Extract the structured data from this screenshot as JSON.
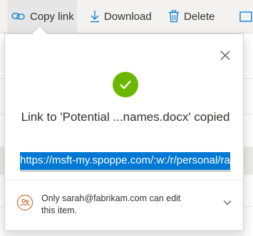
{
  "toolbar": {
    "copy_link_label": "Copy link",
    "download_label": "Download",
    "delete_label": "Delete"
  },
  "dialog": {
    "message": "Link to 'Potential ...names.docx' copied",
    "link_url": "https://msft-my.spoppe.com/:w:/r/personal/ra",
    "permission_text": "Only sarah@fabrikam.com can edit this item."
  },
  "icons": {
    "copy_link": "link-icon",
    "download": "download-icon",
    "delete": "trash-icon",
    "close": "close-icon",
    "success": "checkmark-icon",
    "permission": "people-icon",
    "expand": "chevron-down-icon"
  },
  "colors": {
    "accent": "#0078d4",
    "success": "#6bb700",
    "permission_icon": "#ca5010"
  }
}
